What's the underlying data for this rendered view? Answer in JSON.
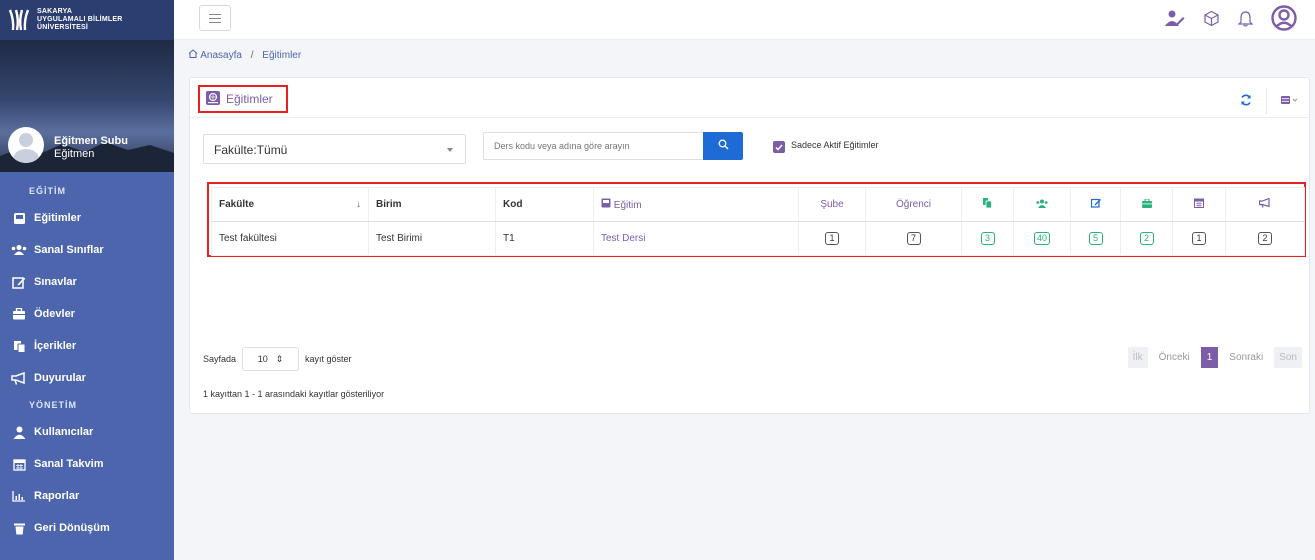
{
  "brand": {
    "line1": "SAKARYA",
    "line2": "UYGULAMALI BİLİMLER",
    "line3": "ÜNİVERSİTESİ"
  },
  "profile": {
    "name": "Eğitmen Subu",
    "role": "Eğitmen"
  },
  "sidebar": {
    "section1": "EĞİTİM",
    "items1": [
      {
        "label": "Eğitimler",
        "icon": "book-icon"
      },
      {
        "label": "Sanal Sınıflar",
        "icon": "users-icon"
      },
      {
        "label": "Sınavlar",
        "icon": "edit-icon"
      },
      {
        "label": "Ödevler",
        "icon": "briefcase-icon"
      },
      {
        "label": "İçerikler",
        "icon": "files-icon"
      },
      {
        "label": "Duyurular",
        "icon": "megaphone-icon"
      }
    ],
    "section2": "YÖNETİM",
    "items2": [
      {
        "label": "Kullanıcılar",
        "icon": "user-icon"
      },
      {
        "label": "Sanal Takvim",
        "icon": "calendar-icon"
      },
      {
        "label": "Raporlar",
        "icon": "chart-icon"
      },
      {
        "label": "Geri Dönüşüm",
        "icon": "trash-icon"
      }
    ]
  },
  "breadcrumb": {
    "home": "Anasayfa",
    "separator": "/",
    "current": "Eğitimler"
  },
  "card": {
    "title": "Eğitimler"
  },
  "filters": {
    "faculty": "Fakülte:Tümü",
    "search_placeholder": "Ders kodu veya adına göre arayın",
    "active_only_label": "Sadece Aktif Eğitimler"
  },
  "table": {
    "headers": {
      "fakulte": "Fakülte",
      "birim": "Birim",
      "kod": "Kod",
      "egitim": "Eğitim",
      "sube": "Şube",
      "ogrenci": "Öğrenci"
    },
    "row": {
      "fakulte": "Test fakültesi",
      "birim": "Test Birimi",
      "kod": "T1",
      "egitim": "Test Dersi",
      "sube": "1",
      "ogrenci": "7",
      "icerik": "3",
      "sanal": "40",
      "sinav": "5",
      "odev": "2",
      "takvim": "1",
      "duyuru": "2"
    }
  },
  "pagination": {
    "prefix": "Sayfada",
    "page_size": "10",
    "suffix": "kayıt göster",
    "info": "1 kayıttan 1 - 1 arasındaki kayıtlar gösteriliyor",
    "first": "İlk",
    "prev": "Önceki",
    "current": "1",
    "next": "Sonraki",
    "last": "Son"
  },
  "colors": {
    "sidebar": "#4c65ad",
    "accent": "#7b5ea7",
    "primary": "#1e6bd6",
    "success": "#2ab27b",
    "highlight": "#e8201f"
  }
}
